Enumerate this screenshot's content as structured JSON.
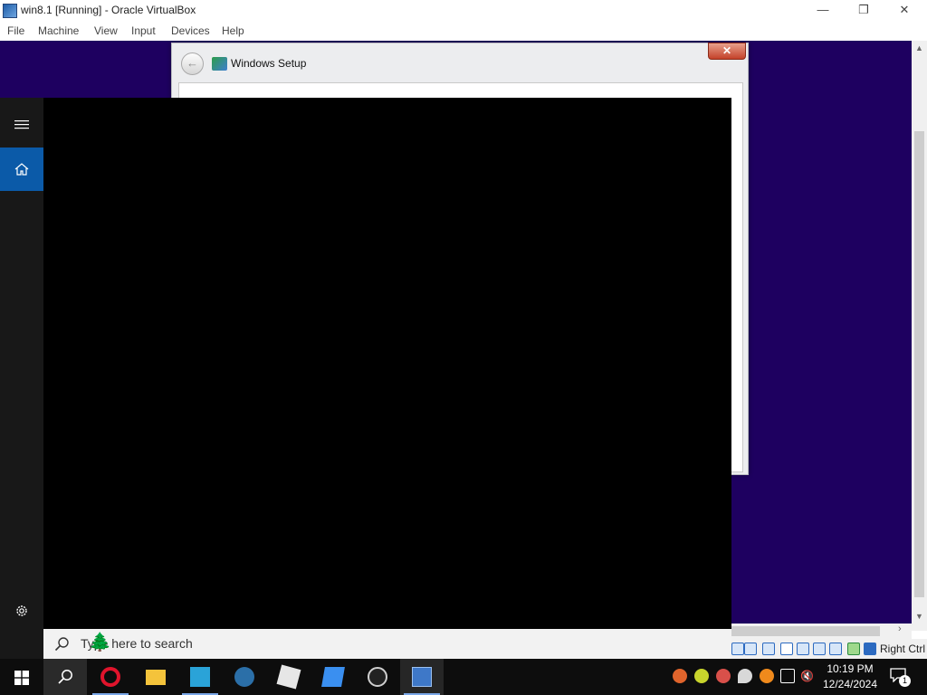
{
  "host_window": {
    "title": "win8.1 [Running] - Oracle VirtualBox",
    "controls": {
      "minimize": "—",
      "restore": "❐",
      "close": "✕"
    }
  },
  "menubar": {
    "items": [
      "File",
      "Machine",
      "View",
      "Input",
      "Devices",
      "Help"
    ]
  },
  "guest": {
    "setup_dialog": {
      "title": "Windows Setup",
      "back_icon": "back-arrow-icon",
      "close_label": "✕"
    }
  },
  "start_menu": {
    "rail": [
      {
        "name": "hamburger-menu-icon"
      },
      {
        "name": "home-icon",
        "active": true
      },
      {
        "name": "settings-icon"
      }
    ],
    "search": {
      "placeholder": "Type here to search",
      "icon": "search-icon"
    }
  },
  "statusbar": {
    "host_key": "Right Ctrl"
  },
  "taskbar": {
    "apps": [
      {
        "name": "opera-icon",
        "color": "#e0142c"
      },
      {
        "name": "file-explorer-icon",
        "color": "#f4c33b"
      },
      {
        "name": "vscode-like-icon",
        "color": "#2aa3d8"
      },
      {
        "name": "steam-icon",
        "color": "#2b6fa8"
      },
      {
        "name": "roblox-icon",
        "color": "#e6e6e6"
      },
      {
        "name": "app-blue-icon",
        "color": "#3a8ff0"
      },
      {
        "name": "obs-icon",
        "color": "#cfcfcf"
      },
      {
        "name": "virtualbox-icon",
        "color": "#3e78c8"
      }
    ],
    "clock": {
      "time": "10:19 PM",
      "date": "12/24/2024"
    },
    "notification_count": "1"
  }
}
